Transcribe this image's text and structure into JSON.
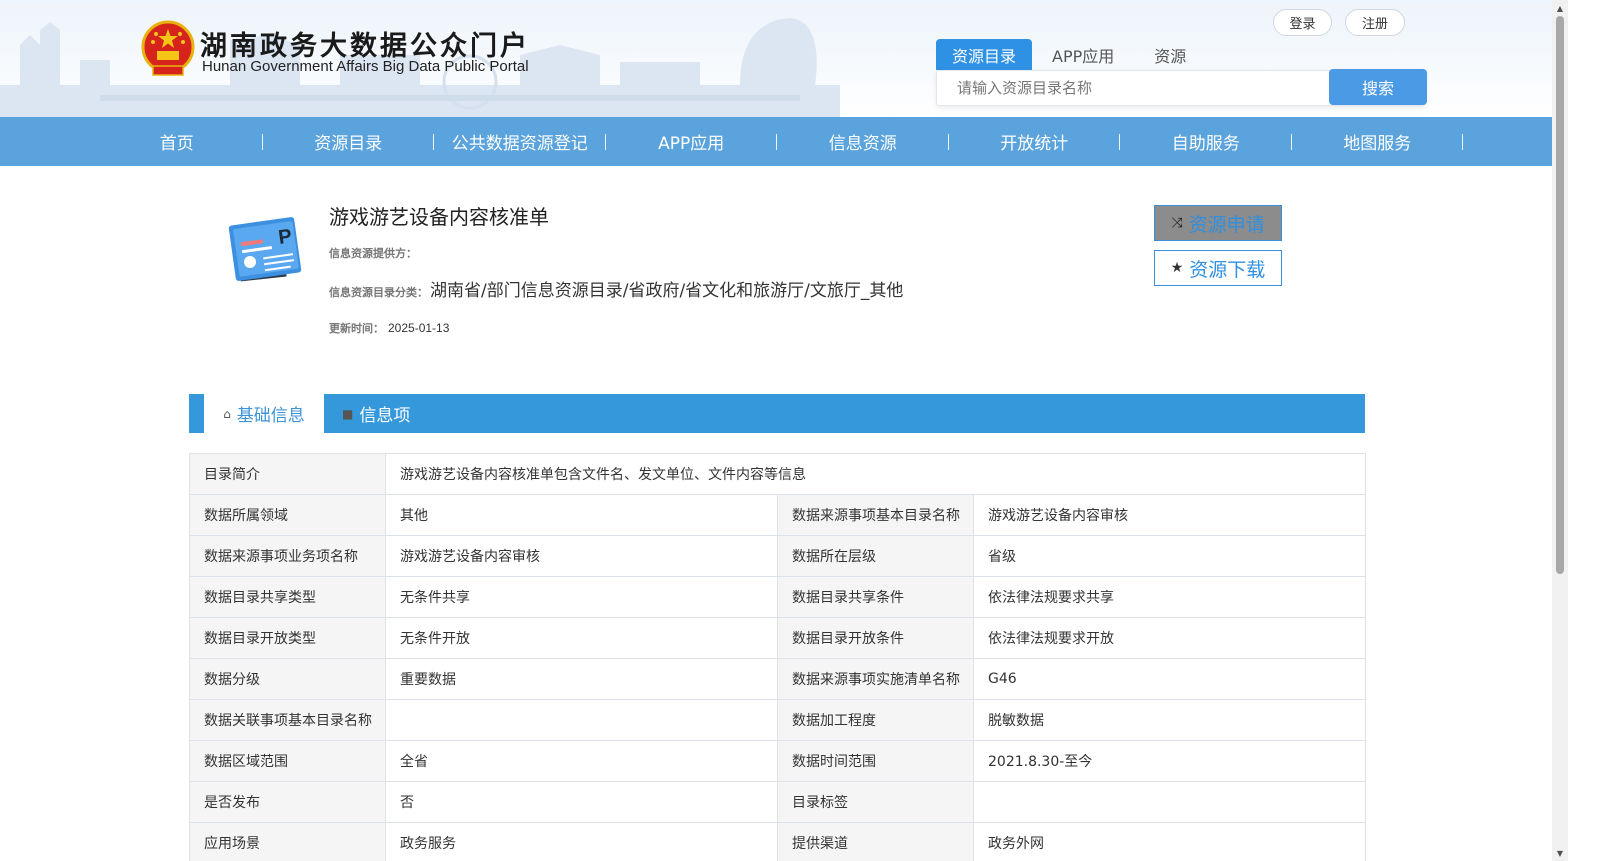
{
  "header": {
    "brand_cn": "湖南政务大数据公众门户",
    "brand_en": "Hunan Government Affairs Big Data Public Portal",
    "login_label": "登录",
    "register_label": "注册"
  },
  "search": {
    "tabs": [
      {
        "label": "资源目录",
        "active": true
      },
      {
        "label": "APP应用",
        "active": false
      },
      {
        "label": "资源",
        "active": false
      }
    ],
    "placeholder": "请输入资源目录名称",
    "button_label": "搜索"
  },
  "nav": {
    "items": [
      {
        "label": "首页"
      },
      {
        "label": "资源目录"
      },
      {
        "label": "公共数据资源登记"
      },
      {
        "label": "APP应用"
      },
      {
        "label": "信息资源"
      },
      {
        "label": "开放统计"
      },
      {
        "label": "自助服务"
      },
      {
        "label": "地图服务"
      }
    ]
  },
  "resource": {
    "title": "游戏游艺设备内容核准单",
    "provider_label": "信息资源提供方：",
    "provider_value": "",
    "category_label": "信息资源目录分类：",
    "category_value": "湖南省/部门信息资源目录/省政府/省文化和旅游厅/文旅厅_其他",
    "update_label": "更新时间：",
    "update_value": "2025-01-13",
    "apply_label": "资源申请",
    "download_label": "资源下载"
  },
  "tabs": {
    "basic_label": "基础信息",
    "items_label": "信息项"
  },
  "info": {
    "intro_label": "目录简介",
    "intro_value": "游戏游艺设备内容核准单包含文件名、发文单位、文件内容等信息",
    "rows": [
      {
        "l1": "数据所属领域",
        "v1": "其他",
        "l2": "数据来源事项基本目录名称",
        "v2": "游戏游艺设备内容审核"
      },
      {
        "l1": "数据来源事项业务项名称",
        "v1": "游戏游艺设备内容审核",
        "l2": "数据所在层级",
        "v2": "省级"
      },
      {
        "l1": "数据目录共享类型",
        "v1": "无条件共享",
        "l2": "数据目录共享条件",
        "v2": "依法律法规要求共享"
      },
      {
        "l1": "数据目录开放类型",
        "v1": "无条件开放",
        "l2": "数据目录开放条件",
        "v2": "依法律法规要求开放"
      },
      {
        "l1": "数据分级",
        "v1": "重要数据",
        "l2": "数据来源事项实施清单名称",
        "v2": "G46"
      },
      {
        "l1": "数据关联事项基本目录名称",
        "v1": "",
        "l2": "数据加工程度",
        "v2": "脱敏数据"
      },
      {
        "l1": "数据区域范围",
        "v1": "全省",
        "l2": "数据时间范围",
        "v2": "2021.8.30-至今"
      },
      {
        "l1": "是否发布",
        "v1": "否",
        "l2": "目录标签",
        "v2": ""
      },
      {
        "l1": "应用场景",
        "v1": "政务服务",
        "l2": "提供渠道",
        "v2": "政务外网"
      }
    ]
  }
}
